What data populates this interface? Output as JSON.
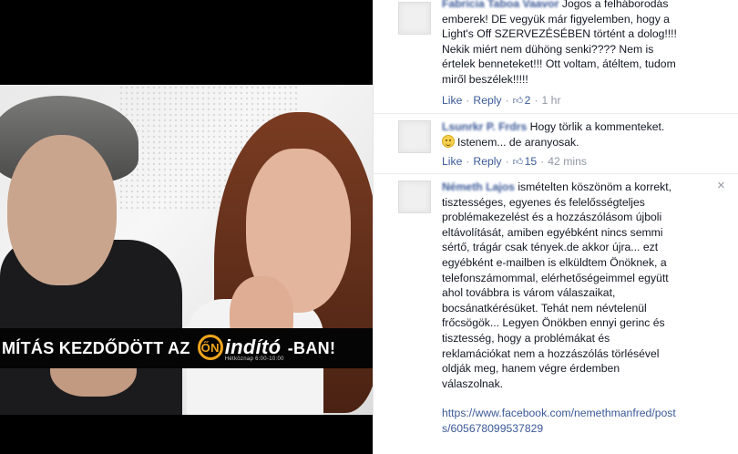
{
  "photo": {
    "banner_left": "MÍTÁS KEZDŐDÖTT AZ",
    "logo_mark": "ŐN",
    "logo_text": "indító",
    "logo_subtext": "Hétköznap 6:00-10:00",
    "banner_right": "-BAN!"
  },
  "comments": [
    {
      "author": "Fabricia Taboa Vaavor",
      "text_lines": [
        "Jogos a felháborodás",
        "emberek! DE vegyük már figyelemben, hogy a",
        "Light's Off SZERVEZÉSÉBEN történt a dolog!!!!",
        "Nekik miért nem dühöng senki???? Nem is",
        "értelek benneteket!!! Ott voltam, átéltem, tudom",
        "miről beszélek!!!!!"
      ],
      "like_label": "Like",
      "reply_label": "Reply",
      "like_count": "2",
      "time": "1 hr"
    },
    {
      "author": "Lsunrkr P. Frdrs",
      "text_first": "Hogy törlik a kommenteket.",
      "text_second": "Istenem... de aranyosak.",
      "emoji": "smile-emoji",
      "like_label": "Like",
      "reply_label": "Reply",
      "like_count": "15",
      "time": "42 mins"
    },
    {
      "author": "Németh Lajos",
      "text_lines": [
        "ismételten köszönöm a korrekt,",
        "tisztességes, egyenes és felelősségteljes",
        "problémakezelést és a hozzászólásom újboli",
        "eltávolítását, amiben egyébként nincs semmi",
        "sértő, trágár csak tények.de akkor újra... ezt",
        "egyébként e-mailben is elküldtem Önöknek, a",
        "telefonszámommal, elérhetőségeimmel együtt",
        "ahol továbbra is várom válaszaikat,",
        "bocsánatkérésüket. Tehát nem névtelenül",
        "frőcsögök... Legyen Önökben ennyi gerinc és",
        "tisztesség, hogy a problémákat és",
        "reklamációkat nem a hozzászólás törlésével",
        "oldják meg, hanem végre érdemben",
        "válaszolnak."
      ],
      "url_line1": "https://www.facebook.com/nemethmanfred/post",
      "url_line2": "s/605678099537829",
      "close_icon": "×"
    }
  ]
}
